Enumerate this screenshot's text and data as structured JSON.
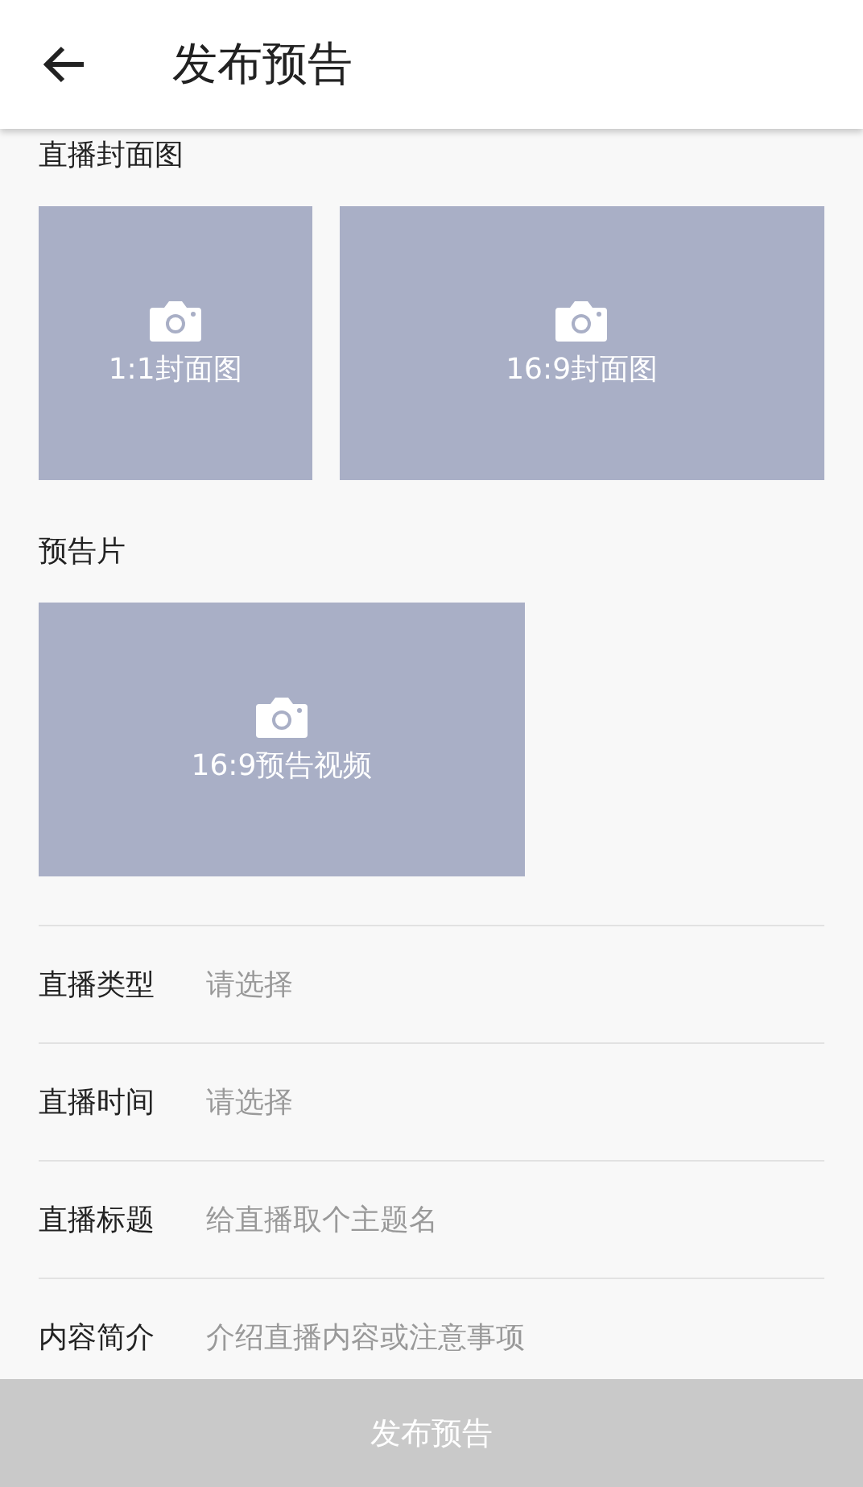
{
  "header": {
    "title": "发布预告"
  },
  "cover_section": {
    "label": "直播封面图",
    "tiles": [
      {
        "label": "1:1封面图",
        "kind": "square"
      },
      {
        "label": "16:9封面图",
        "kind": "wide"
      }
    ]
  },
  "trailer_section": {
    "label": "预告片",
    "tiles": [
      {
        "label": "16:9预告视频",
        "kind": "wide"
      }
    ]
  },
  "form_rows": [
    {
      "label": "直播类型",
      "placeholder": "请选择"
    },
    {
      "label": "直播时间",
      "placeholder": "请选择"
    },
    {
      "label": "直播标题",
      "placeholder": "给直播取个主题名"
    },
    {
      "label": "内容简介",
      "placeholder": "介绍直播内容或注意事项"
    }
  ],
  "submit_button": {
    "label": "发布预告",
    "disabled": true
  }
}
